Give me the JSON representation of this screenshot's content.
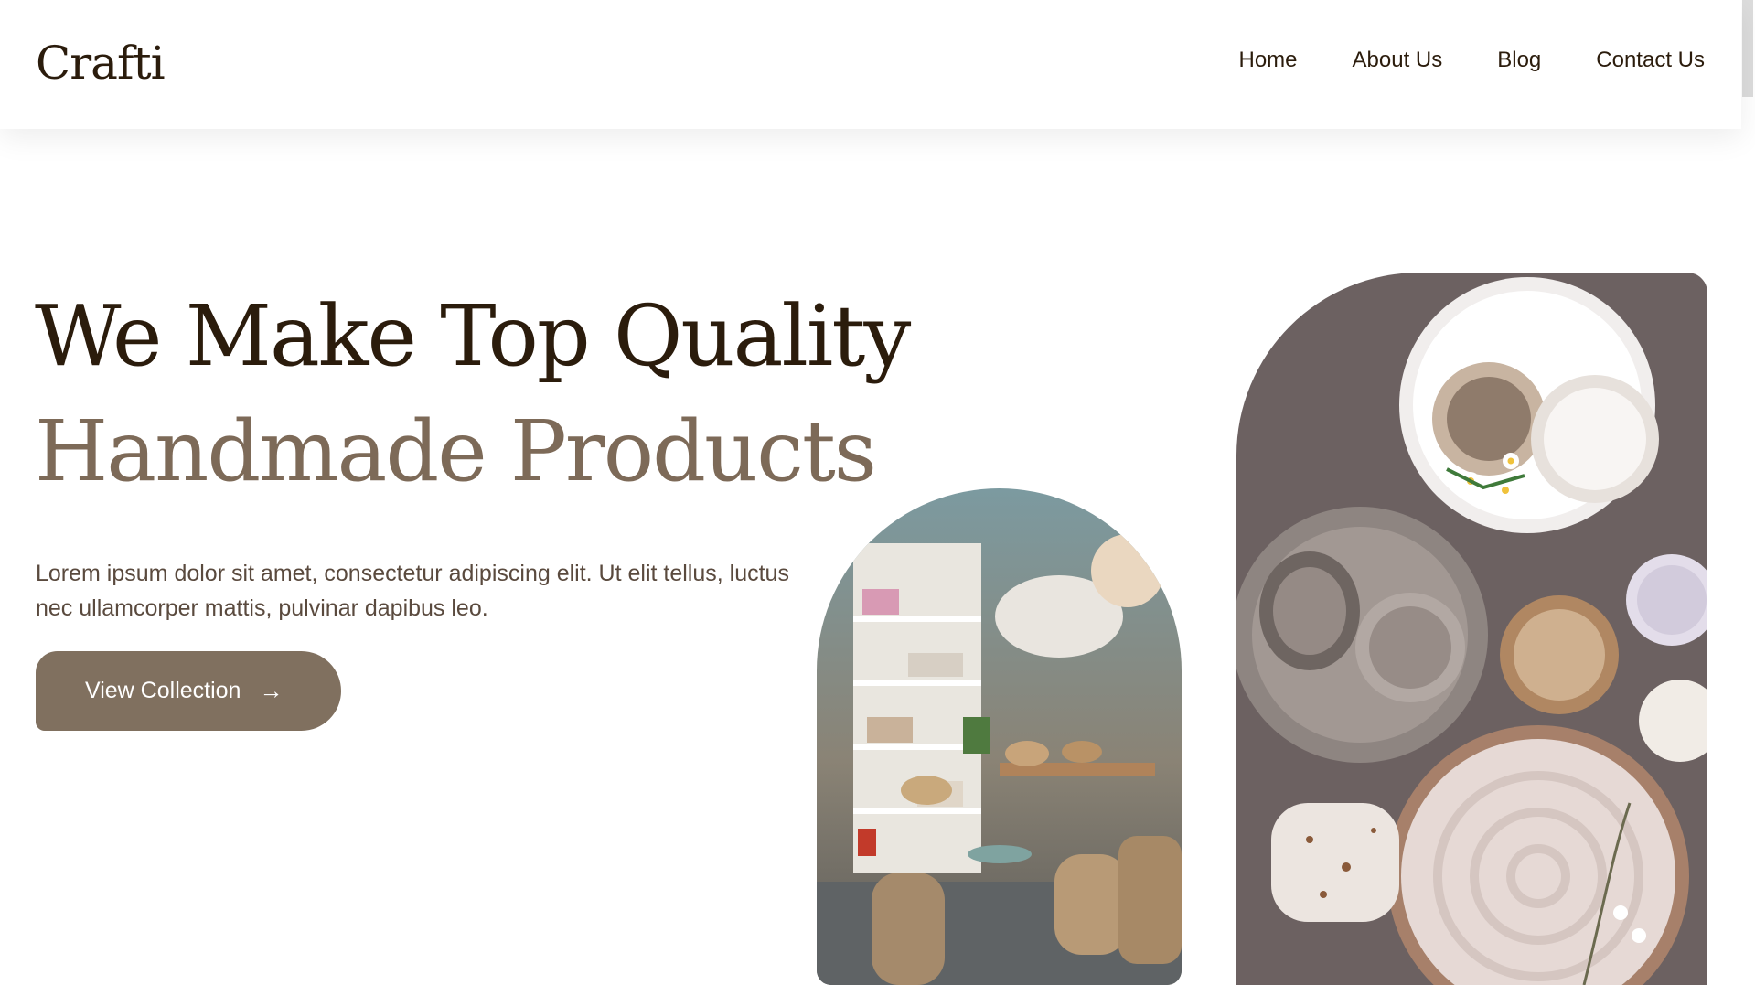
{
  "brand": {
    "logo": "Crafti"
  },
  "nav": {
    "items": [
      {
        "label": "Home"
      },
      {
        "label": "About Us"
      },
      {
        "label": "Blog"
      },
      {
        "label": "Contact Us"
      }
    ]
  },
  "hero": {
    "title_line1": "We Make Top Quality",
    "title_line2": "Handmade Products",
    "description": "Lorem ipsum dolor sit amet, consectetur adipiscing elit. Ut elit tellus, luctus nec ullamcorper mattis, pulvinar dapibus leo.",
    "cta_label": "View Collection"
  },
  "colors": {
    "dark_text": "#2b1c0c",
    "accent_brown": "#80705f",
    "light_brown_text": "#7d6a58"
  },
  "icons": {
    "cta_arrow": "arrow-right-icon"
  }
}
